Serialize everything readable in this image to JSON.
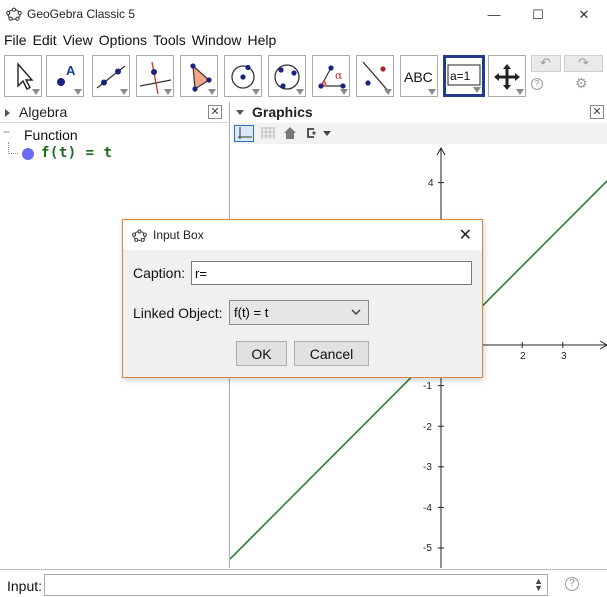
{
  "window": {
    "title": "GeoGebra Classic 5",
    "minimize_glyph": "—",
    "maximize_glyph": "☐",
    "close_glyph": "✕"
  },
  "menu": [
    "File",
    "Edit",
    "View",
    "Options",
    "Tools",
    "Window",
    "Help"
  ],
  "toolbar": {
    "tools": [
      {
        "name": "move-tool-icon"
      },
      {
        "name": "point-tool-icon",
        "glyph": "A"
      },
      {
        "name": "line-tool-icon"
      },
      {
        "name": "perpendicular-line-tool-icon"
      },
      {
        "name": "polygon-tool-icon"
      },
      {
        "name": "circle-center-point-tool-icon"
      },
      {
        "name": "circle-three-points-tool-icon"
      },
      {
        "name": "angle-tool-icon",
        "glyph": "α"
      },
      {
        "name": "reflect-tool-icon"
      },
      {
        "name": "text-tool-icon",
        "glyph": "ABC"
      },
      {
        "name": "slider-tool-icon",
        "glyph": "a=1"
      },
      {
        "name": "move-graphics-view-tool-icon"
      }
    ],
    "undo_glyph": "↶",
    "redo_glyph": "↷",
    "help_glyph": "?",
    "settings_glyph": "⚙"
  },
  "algebra": {
    "title": "Algebra",
    "close_glyph": "✕",
    "tree": {
      "expand_glyph": "−",
      "category": "Function",
      "items": [
        {
          "label": "f(t)  =  t",
          "color": "#1a6b1a",
          "dot_color": "#6a6af0"
        }
      ]
    }
  },
  "graphics": {
    "title": "Graphics",
    "close_glyph": "✕",
    "x_ticks": [
      "1",
      "2",
      "3"
    ],
    "y_ticks": [
      "4",
      "-1",
      "-2",
      "-3",
      "-4",
      "-5"
    ],
    "line_color": "#2e7d32"
  },
  "input_bar": {
    "label": "Input:",
    "value": "",
    "help_glyph": "?"
  },
  "dialog": {
    "title": "Input Box",
    "close_glyph": "✕",
    "caption_label": "Caption:",
    "caption_value": "r=",
    "linked_label": "Linked Object:",
    "linked_value": "f(t) = t",
    "ok_label": "OK",
    "cancel_label": "Cancel"
  }
}
